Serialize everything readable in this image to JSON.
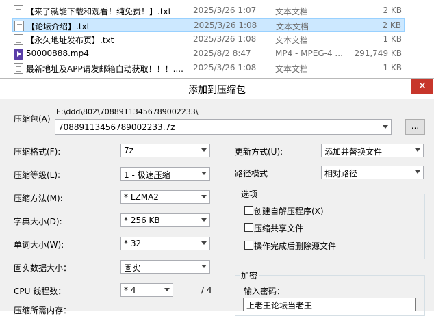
{
  "file_list": {
    "rows": [
      {
        "name": "【来了就能下载和观看！纯免费！】.txt",
        "date": "2025/3/26 1:07",
        "type": "文本文档",
        "size": "2 KB",
        "icon": "txt-file-icon",
        "selected": false
      },
      {
        "name": "【论坛介绍】.txt",
        "date": "2025/3/26 1:08",
        "type": "文本文档",
        "size": "2 KB",
        "icon": "txt-file-icon",
        "selected": true
      },
      {
        "name": "【永久地址发布页】.txt",
        "date": "2025/3/26 1:08",
        "type": "文本文档",
        "size": "1 KB",
        "icon": "txt-file-icon",
        "selected": false
      },
      {
        "name": "50000888.mp4",
        "date": "2025/8/2 8:47",
        "type": "MP4 - MPEG-4 ...",
        "size": "291,749 KB",
        "icon": "mp4-file-icon",
        "selected": false
      },
      {
        "name": "最新地址及APP请发邮箱自动获取！！！....",
        "date": "2025/3/26 1:08",
        "type": "文本文档",
        "size": "1 KB",
        "icon": "txt-file-icon",
        "selected": false
      }
    ]
  },
  "dialog": {
    "title": "添加到压缩包",
    "close_glyph": "✕",
    "archive": {
      "label": "压缩包(A)",
      "path": "E:\\ddd\\802\\70889113456789002233\\",
      "filename": "70889113456789002233.7z",
      "browse_label": "..."
    },
    "format": {
      "label": "压缩格式(F):",
      "value": "7z"
    },
    "level": {
      "label": "压缩等级(L):",
      "value": "1 - 极速压缩"
    },
    "method": {
      "label": "压缩方法(M):",
      "value": "* LZMA2"
    },
    "dict": {
      "label": "字典大小(D):",
      "value": "* 256 KB"
    },
    "word": {
      "label": "单词大小(W):",
      "value": "* 32"
    },
    "solid": {
      "label": "固实数据大小：",
      "value": "固实"
    },
    "cpu": {
      "label": "CPU 线程数：",
      "value": "* 4",
      "total": "/ 4"
    },
    "memory": {
      "label": "压缩所需内存："
    },
    "update": {
      "label": "更新方式(U):",
      "value": "添加并替换文件"
    },
    "pathmode": {
      "label": "路径模式",
      "value": "相对路径"
    },
    "options": {
      "title": "选项",
      "items": [
        "创建自解压程序(X)",
        "压缩共享文件",
        "操作完成后删除源文件"
      ]
    },
    "encrypt": {
      "title": "加密",
      "password_label": "输入密码：",
      "password_value": "上老王论坛当老王"
    }
  }
}
